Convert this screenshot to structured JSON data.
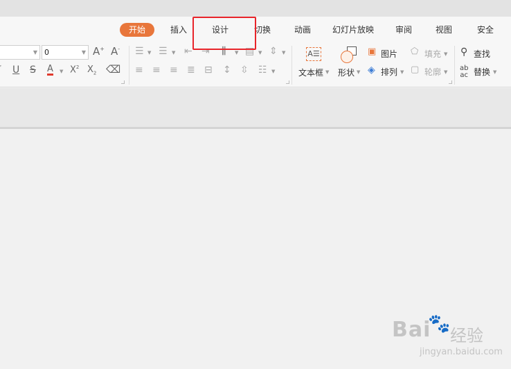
{
  "tabs": [
    {
      "label": "开始",
      "active": true
    },
    {
      "label": "插入"
    },
    {
      "label": "设计"
    },
    {
      "label": "切换"
    },
    {
      "label": "动画"
    },
    {
      "label": "幻灯片放映"
    },
    {
      "label": "审阅"
    },
    {
      "label": "视图"
    },
    {
      "label": "安全"
    }
  ],
  "font": {
    "name": "",
    "size": "0"
  },
  "insert": {
    "textbox": "文本框",
    "shape": "形状",
    "picture": "图片",
    "arrange": "排列"
  },
  "draw": {
    "fill": "填充",
    "outline": "轮廓"
  },
  "edit": {
    "find": "查找",
    "replace": "替换"
  },
  "watermark": {
    "brand": "Bai",
    "brand2": "经验",
    "url": "jingyan.baidu.com"
  },
  "colors": {
    "accent": "#e8763b",
    "highlight": "#e8242a",
    "font_color_bar": "#e03a2e"
  }
}
